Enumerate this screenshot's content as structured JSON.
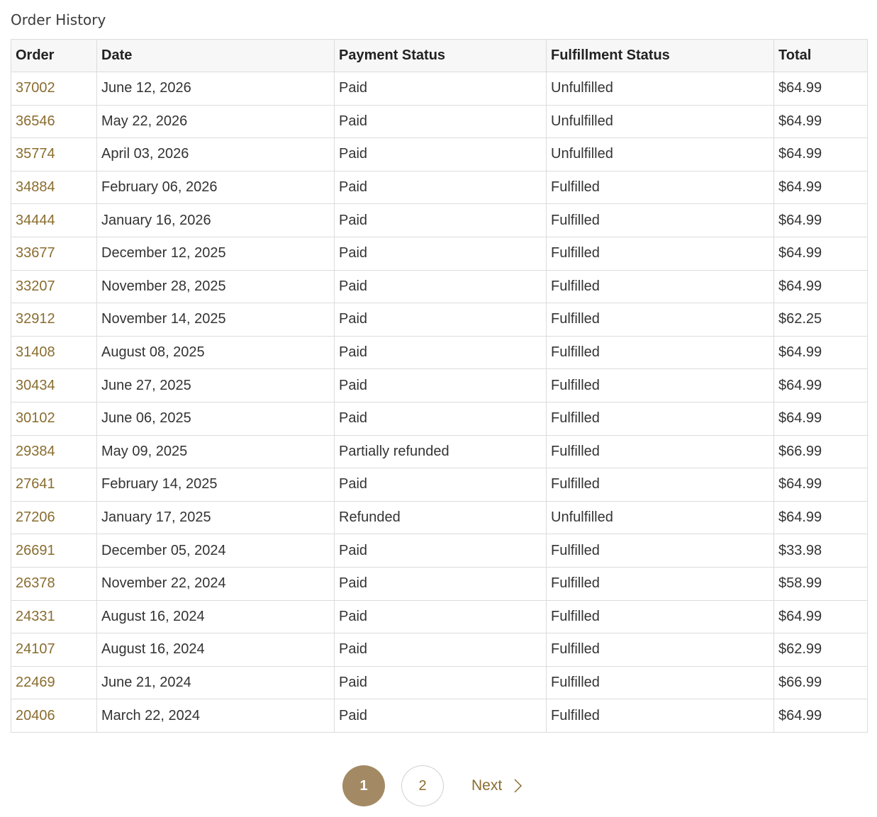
{
  "page": {
    "title": "Order History"
  },
  "table": {
    "columns": [
      "Order",
      "Date",
      "Payment Status",
      "Fulfillment Status",
      "Total"
    ],
    "rows": [
      {
        "order": "37002",
        "date": "June 12, 2026",
        "payment": "Paid",
        "fulfillment": "Unfulfilled",
        "total": "$64.99"
      },
      {
        "order": "36546",
        "date": "May 22, 2026",
        "payment": "Paid",
        "fulfillment": "Unfulfilled",
        "total": "$64.99"
      },
      {
        "order": "35774",
        "date": "April 03, 2026",
        "payment": "Paid",
        "fulfillment": "Unfulfilled",
        "total": "$64.99"
      },
      {
        "order": "34884",
        "date": "February 06, 2026",
        "payment": "Paid",
        "fulfillment": "Fulfilled",
        "total": "$64.99"
      },
      {
        "order": "34444",
        "date": "January 16, 2026",
        "payment": "Paid",
        "fulfillment": "Fulfilled",
        "total": "$64.99"
      },
      {
        "order": "33677",
        "date": "December 12, 2025",
        "payment": "Paid",
        "fulfillment": "Fulfilled",
        "total": "$64.99"
      },
      {
        "order": "33207",
        "date": "November 28, 2025",
        "payment": "Paid",
        "fulfillment": "Fulfilled",
        "total": "$64.99"
      },
      {
        "order": "32912",
        "date": "November 14, 2025",
        "payment": "Paid",
        "fulfillment": "Fulfilled",
        "total": "$62.25"
      },
      {
        "order": "31408",
        "date": "August 08, 2025",
        "payment": "Paid",
        "fulfillment": "Fulfilled",
        "total": "$64.99"
      },
      {
        "order": "30434",
        "date": "June 27, 2025",
        "payment": "Paid",
        "fulfillment": "Fulfilled",
        "total": "$64.99"
      },
      {
        "order": "30102",
        "date": "June 06, 2025",
        "payment": "Paid",
        "fulfillment": "Fulfilled",
        "total": "$64.99"
      },
      {
        "order": "29384",
        "date": "May 09, 2025",
        "payment": "Partially refunded",
        "fulfillment": "Fulfilled",
        "total": "$66.99"
      },
      {
        "order": "27641",
        "date": "February 14, 2025",
        "payment": "Paid",
        "fulfillment": "Fulfilled",
        "total": "$64.99"
      },
      {
        "order": "27206",
        "date": "January 17, 2025",
        "payment": "Refunded",
        "fulfillment": "Unfulfilled",
        "total": "$64.99"
      },
      {
        "order": "26691",
        "date": "December 05, 2024",
        "payment": "Paid",
        "fulfillment": "Fulfilled",
        "total": "$33.98"
      },
      {
        "order": "26378",
        "date": "November 22, 2024",
        "payment": "Paid",
        "fulfillment": "Fulfilled",
        "total": "$58.99"
      },
      {
        "order": "24331",
        "date": "August 16, 2024",
        "payment": "Paid",
        "fulfillment": "Fulfilled",
        "total": "$64.99"
      },
      {
        "order": "24107",
        "date": "August 16, 2024",
        "payment": "Paid",
        "fulfillment": "Fulfilled",
        "total": "$62.99"
      },
      {
        "order": "22469",
        "date": "June 21, 2024",
        "payment": "Paid",
        "fulfillment": "Fulfilled",
        "total": "$66.99"
      },
      {
        "order": "20406",
        "date": "March 22, 2024",
        "payment": "Paid",
        "fulfillment": "Fulfilled",
        "total": "$64.99"
      }
    ]
  },
  "pagination": {
    "current_page": "1",
    "other_page": "2",
    "next_label": "Next",
    "next_icon": "chevron-right-icon"
  },
  "colors": {
    "accent": "#a38a64",
    "link": "#8a6d2f",
    "header_bg": "#f7f7f7",
    "border": "#dcdcdc"
  }
}
